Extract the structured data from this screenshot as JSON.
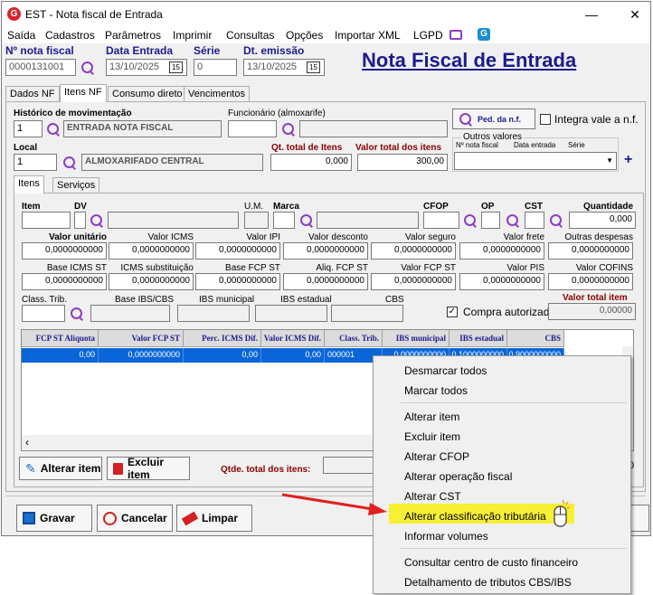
{
  "window": {
    "title": "EST - Nota fiscal de Entrada",
    "logo": "G",
    "minimize": "—",
    "close": "✕"
  },
  "menu": [
    "Saída",
    "Cadastros",
    "Parâmetros",
    "Imprimir",
    "Consultas",
    "Opções",
    "Importar XML",
    "LGPD"
  ],
  "header": {
    "nota_label": "Nº nota fiscal",
    "nota_value": "0000131001",
    "data_entrada_label": "Data Entrada",
    "data_entrada_value": "13/10/2025",
    "serie_label": "Série",
    "serie_value": "0",
    "emissao_label": "Dt. emissão",
    "emissao_value": "13/10/2025",
    "cal": "15",
    "page_title": "Nota Fiscal de Entrada"
  },
  "tabs": [
    "Dados NF",
    "Itens NF",
    "Consumo direto",
    "Vencimentos"
  ],
  "form": {
    "hist_label": "Histórico de movimentação",
    "hist_code": "1",
    "hist_desc": "ENTRADA NOTA FISCAL",
    "func_label": "Funcionário (almoxarife)",
    "ped_btn": "Ped. da n.f.",
    "integra_label": "Integra vale a n.f.",
    "local_label": "Local",
    "local_code": "1",
    "local_desc": "ALMOXARIFADO CENTRAL",
    "qt_label": "Qt. total de Itens",
    "qt_value": "0,000",
    "vt_label": "Valor total dos itens",
    "vt_value": "300,00",
    "outros_label": "Outros valores",
    "outros_cols": [
      "Nº nota fiscal",
      "Data entrada",
      "Série"
    ],
    "plus": "+"
  },
  "subtabs": [
    "Itens",
    "Serviços"
  ],
  "item": {
    "item": "Item",
    "dv": "DV",
    "um": "U.M.",
    "marca": "Marca",
    "cfop": "CFOP",
    "op": "OP",
    "cst": "CST",
    "qtd": "Quantidade",
    "qtd_value": "0,000",
    "row1": [
      [
        "Valor unitário",
        "0,0000000000"
      ],
      [
        "Valor ICMS",
        "0,0000000000"
      ],
      [
        "Valor IPI",
        "0,0000000000"
      ],
      [
        "Valor desconto",
        "0,0000000000"
      ],
      [
        "Valor seguro",
        "0,0000000000"
      ],
      [
        "Valor frete",
        "0,0000000000"
      ],
      [
        "Outras despesas",
        "0,0000000000"
      ]
    ],
    "row2": [
      [
        "Base ICMS ST",
        "0,0000000000"
      ],
      [
        "ICMS substituição",
        "0,0000000000"
      ],
      [
        "Base FCP ST",
        "0,0000000000"
      ],
      [
        "Aliq. FCP ST",
        "0,0000000000"
      ],
      [
        "Valor FCP ST",
        "0,0000000000"
      ],
      [
        "Valor PIS",
        "0,0000000000"
      ],
      [
        "Valor COFINS",
        "0,0000000000"
      ]
    ],
    "class_label": "Class. Trib.",
    "ibs_base": "Base IBS/CBS",
    "ibs_mun": "IBS municipal",
    "ibs_est": "IBS estadual",
    "cbs": "CBS",
    "compra": "Compra autorizada",
    "vti_label": "Valor total item",
    "vti_value": "0,00000"
  },
  "grid": {
    "headers": [
      "FCP ST Aliquota",
      "Valor FCP ST",
      "Perc. ICMS Dif.",
      "Valor ICMS Dif.",
      "Class. Trib.",
      "IBS municipal",
      "IBS estadual",
      "CBS"
    ],
    "row": [
      "0,00",
      "0,0000000000",
      "0,00",
      "0,00",
      "000001",
      "0,0000000000",
      "0,1000000000",
      "0,9000000000"
    ]
  },
  "bottom": {
    "alterar": "Alterar item",
    "excluir": "Excluir item",
    "qtde_label": "Qtde. total dos itens:",
    "gravar": "Gravar",
    "cancelar": "Cancelar",
    "limpar": "Limpar",
    "right_val": "0"
  },
  "context_menu": [
    "Desmarcar todos",
    "Marcar todos",
    "Alterar item",
    "Excluir item",
    "Alterar CFOP",
    "Alterar operação fiscal",
    "Alterar CST",
    "Alterar classificação tributária",
    "Informar volumes",
    "Consultar centro de custo financeiro",
    "Detalhamento de tributos CBS/IBS"
  ],
  "colors": {
    "accent": "#1c1c8c",
    "selection": "#0a66d8",
    "highlight": "#f7f035",
    "arrow": "#e02020"
  }
}
